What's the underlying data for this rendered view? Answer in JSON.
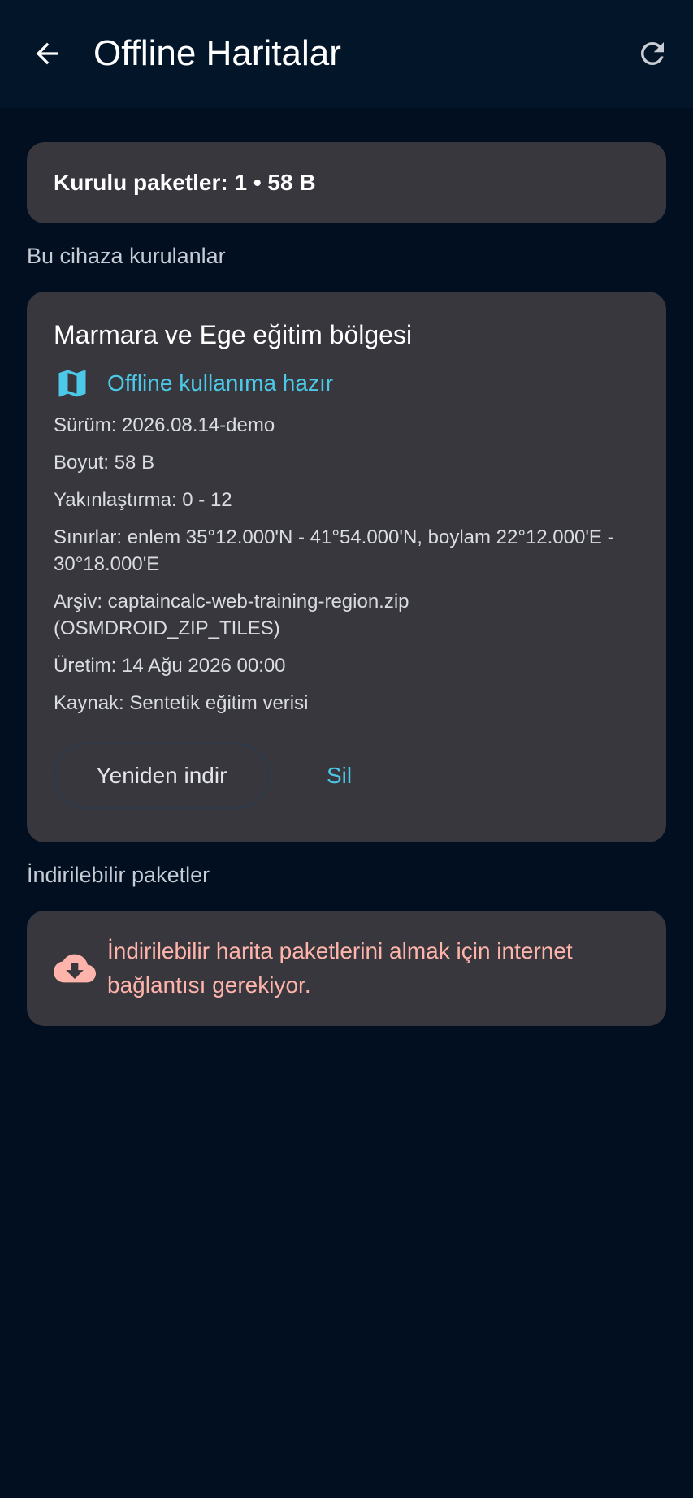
{
  "appbar": {
    "title": "Offline Haritalar",
    "back_icon": "arrow-back-icon",
    "refresh_icon": "refresh-icon"
  },
  "summary": {
    "text": "Kurulu paketler: 1 • 58 B"
  },
  "installed_section": {
    "label": "Bu cihaza kurulanlar"
  },
  "package": {
    "title": "Marmara ve Ege eğitim bölgesi",
    "status_icon": "map-icon",
    "status": "Offline kullanıma hazır",
    "details": [
      "Sürüm: 2026.08.14-demo",
      "Boyut: 58 B",
      "Yakınlaştırma: 0 - 12",
      "Sınırlar: enlem 35°12.000'N - 41°54.000'N, boylam 22°12.000'E - 30°18.000'E",
      "Arşiv: captaincalc-web-training-region.zip (OSMDROID_ZIP_TILES)",
      "Üretim: 14 Ağu 2026 00:00",
      "Kaynak: Sentetik eğitim verisi"
    ],
    "redownload_label": "Yeniden indir",
    "delete_label": "Sil"
  },
  "available_section": {
    "label": "İndirilebilir paketler",
    "error_icon": "cloud-download-icon",
    "error_text": "İndirilebilir harita paketlerini almak için internet bağlantısı gerekiyor."
  },
  "colors": {
    "background": "#010f20",
    "appbar": "#031629",
    "card": "#37373d",
    "accent": "#4cc9e8",
    "error": "#ffb4ab"
  }
}
